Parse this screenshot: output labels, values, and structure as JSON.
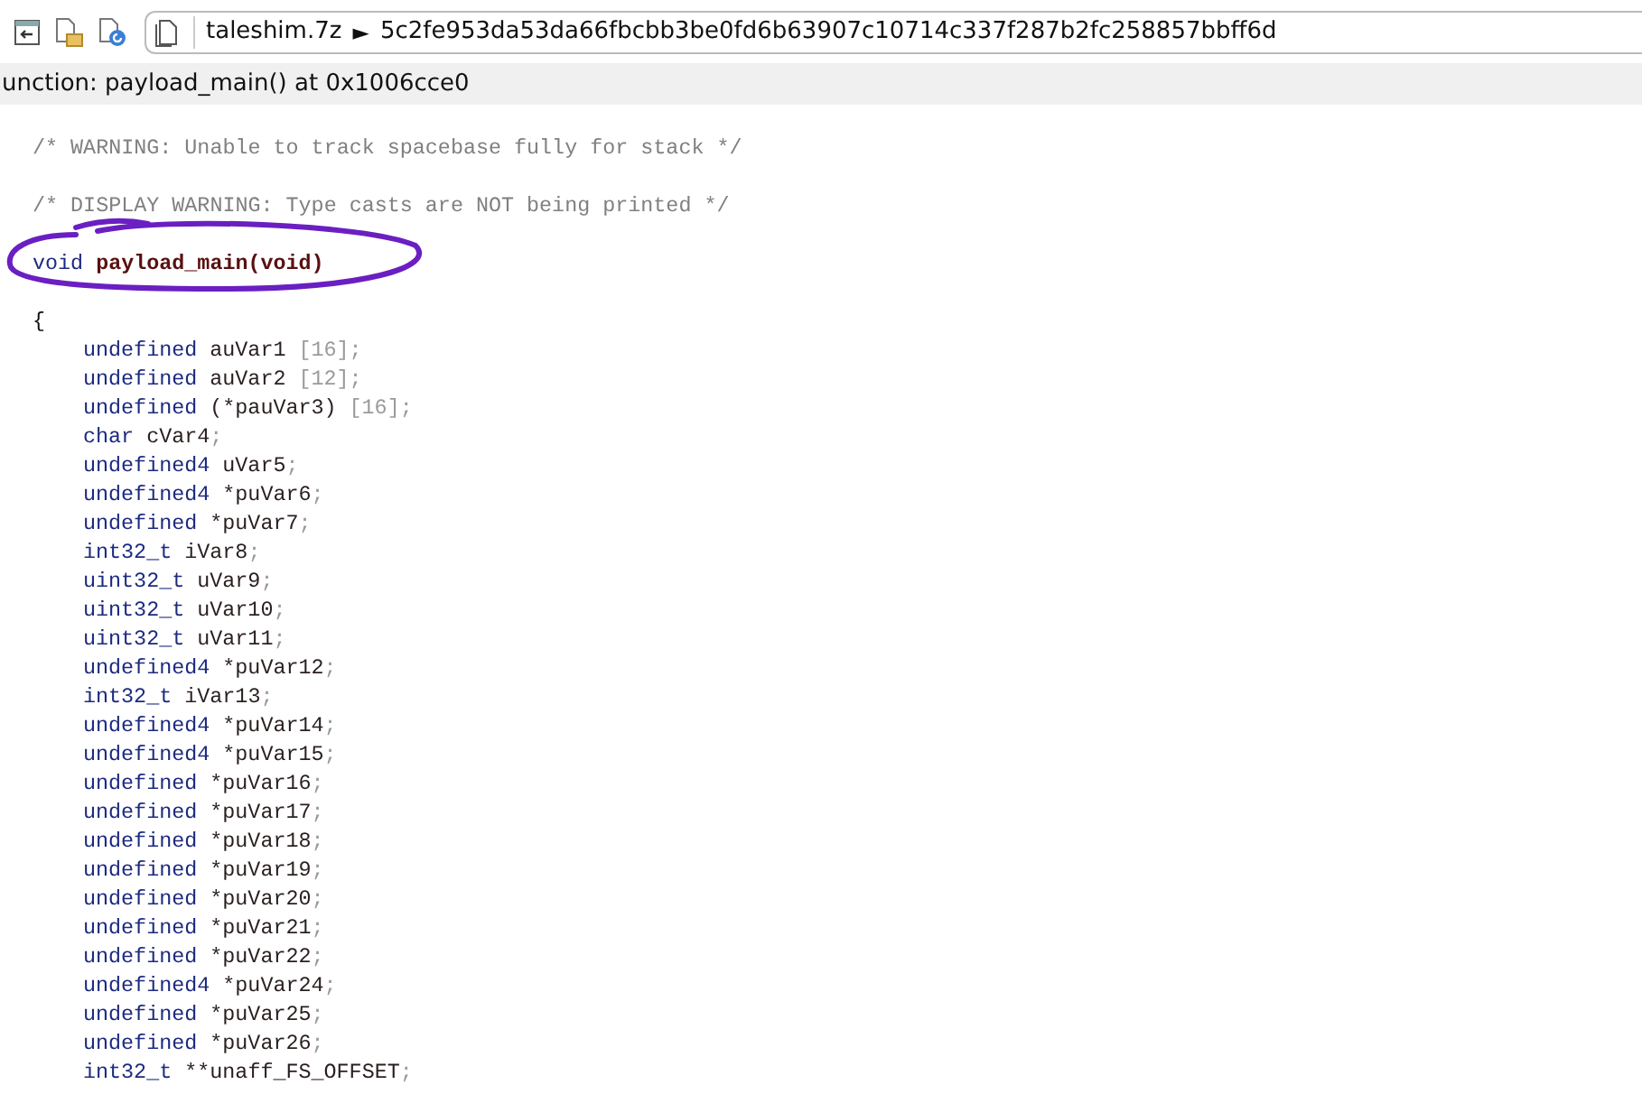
{
  "breadcrumb": {
    "items": [
      "taleshim.7z",
      "5c2fe953da53da66fbcbb3be0fd6b63907c10714c337f287b2fc258857bbff6d"
    ],
    "separator": "►"
  },
  "function_label": "unction: payload_main() at 0x1006cce0",
  "code_lines": [
    {
      "kind": "blank"
    },
    {
      "kind": "comment",
      "text": "/* WARNING: Unable to track spacebase fully for stack */"
    },
    {
      "kind": "blank"
    },
    {
      "kind": "comment",
      "text": "/* DISPLAY WARNING: Type casts are NOT being printed */"
    },
    {
      "kind": "blank"
    },
    {
      "kind": "signature",
      "ret": "void",
      "name": "payload_main(void)"
    },
    {
      "kind": "blank"
    },
    {
      "kind": "brace",
      "text": "{"
    },
    {
      "kind": "decl",
      "type": "undefined",
      "name": "auVar1",
      "array": "[16]",
      "end": ";"
    },
    {
      "kind": "decl",
      "type": "undefined",
      "name": "auVar2",
      "array": "[12]",
      "end": ";"
    },
    {
      "kind": "decl",
      "type": "undefined",
      "name": "(*pauVar3)",
      "array": "[16]",
      "end": ";"
    },
    {
      "kind": "decl",
      "type": "char",
      "name": "cVar4",
      "end": ";"
    },
    {
      "kind": "decl",
      "type": "undefined4",
      "name": "uVar5",
      "end": ";"
    },
    {
      "kind": "decl",
      "type": "undefined4",
      "name": "*puVar6",
      "end": ";"
    },
    {
      "kind": "decl",
      "type": "undefined",
      "name": "*puVar7",
      "end": ";"
    },
    {
      "kind": "decl",
      "type": "int32_t",
      "name": "iVar8",
      "end": ";"
    },
    {
      "kind": "decl",
      "type": "uint32_t",
      "name": "uVar9",
      "end": ";"
    },
    {
      "kind": "decl",
      "type": "uint32_t",
      "name": "uVar10",
      "end": ";"
    },
    {
      "kind": "decl",
      "type": "uint32_t",
      "name": "uVar11",
      "end": ";"
    },
    {
      "kind": "decl",
      "type": "undefined4",
      "name": "*puVar12",
      "end": ";"
    },
    {
      "kind": "decl",
      "type": "int32_t",
      "name": "iVar13",
      "end": ";"
    },
    {
      "kind": "decl",
      "type": "undefined4",
      "name": "*puVar14",
      "end": ";"
    },
    {
      "kind": "decl",
      "type": "undefined4",
      "name": "*puVar15",
      "end": ";"
    },
    {
      "kind": "decl",
      "type": "undefined",
      "name": "*puVar16",
      "end": ";"
    },
    {
      "kind": "decl",
      "type": "undefined",
      "name": "*puVar17",
      "end": ";"
    },
    {
      "kind": "decl",
      "type": "undefined",
      "name": "*puVar18",
      "end": ";"
    },
    {
      "kind": "decl",
      "type": "undefined",
      "name": "*puVar19",
      "end": ";"
    },
    {
      "kind": "decl",
      "type": "undefined",
      "name": "*puVar20",
      "end": ";"
    },
    {
      "kind": "decl",
      "type": "undefined",
      "name": "*puVar21",
      "end": ";"
    },
    {
      "kind": "decl",
      "type": "undefined",
      "name": "*puVar22",
      "end": ";"
    },
    {
      "kind": "decl",
      "type": "undefined4",
      "name": "*puVar24",
      "end": ";"
    },
    {
      "kind": "decl",
      "type": "undefined",
      "name": "*puVar25",
      "end": ";"
    },
    {
      "kind": "decl",
      "type": "undefined",
      "name": "*puVar26",
      "end": ";"
    },
    {
      "kind": "decl",
      "type": "int32_t",
      "name": "**unaff_FS_OFFSET",
      "end": ";"
    }
  ]
}
